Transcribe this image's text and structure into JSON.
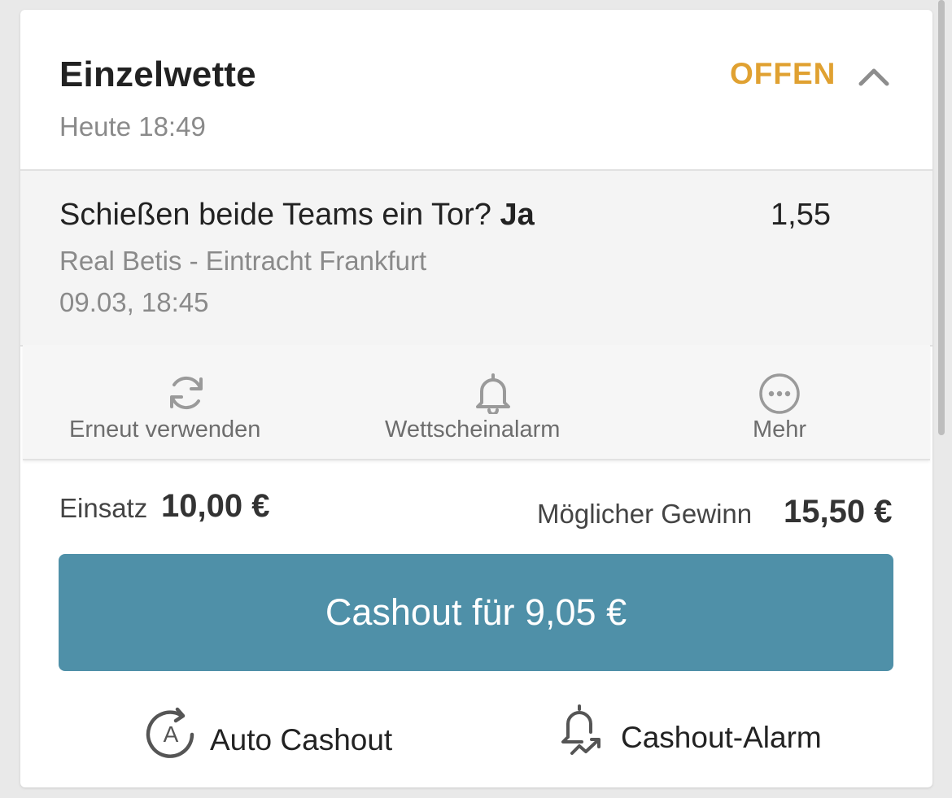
{
  "bet": {
    "type_title": "Einzelwette",
    "placed_time": "Heute 18:49",
    "status": "OFFEN",
    "status_color": "#e0a131",
    "collapse_icon": "chevron-up-icon"
  },
  "selection": {
    "market_question": "Schießen beide Teams ein Tor? ",
    "market_pick": "Ja",
    "odds": "1,55",
    "event": "Real Betis - Eintracht Frankfurt",
    "event_datetime": "09.03, 18:45"
  },
  "actions": [
    {
      "label": "Erneut verwenden",
      "icon": "refresh-icon"
    },
    {
      "label": "Wettscheinalarm",
      "icon": "bell-icon"
    },
    {
      "label": "Mehr",
      "icon": "more-icon"
    }
  ],
  "summary": {
    "stake_label": "Einsatz",
    "stake_value": "10,00 €",
    "win_label": "Möglicher Gewinn",
    "win_value": "15,50 €"
  },
  "cashout": {
    "button_label": "Cashout für 9,05 €",
    "button_color": "#4f90a8"
  },
  "options": [
    {
      "label": "Auto Cashout",
      "icon": "auto-cashout-icon"
    },
    {
      "label": "Cashout-Alarm",
      "icon": "cashout-alarm-icon"
    }
  ]
}
